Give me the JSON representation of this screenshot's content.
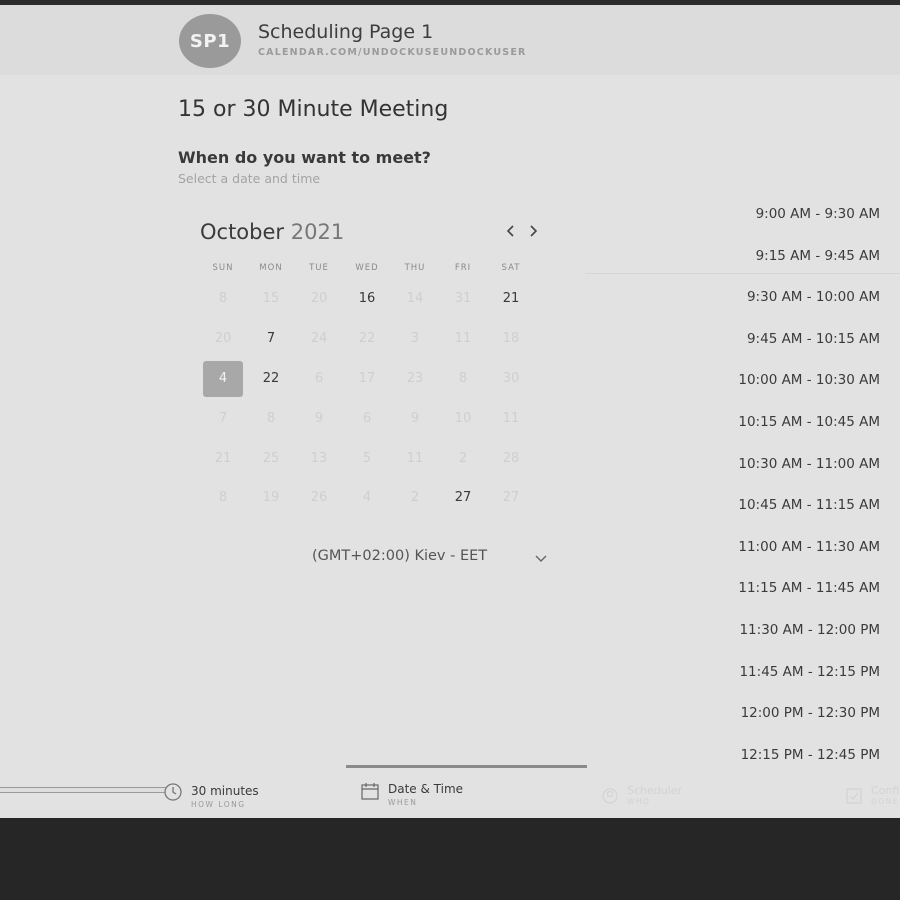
{
  "header": {
    "avatar_initials": "SP1",
    "title": "Scheduling Page 1",
    "url": "CALENDAR.COM/UNDOCKUSEUNDOCKUSER"
  },
  "meeting": {
    "title": "15 or 30 Minute Meeting",
    "question": "When do you want to meet?",
    "subtitle": "Select a date and time"
  },
  "calendar": {
    "month": "October",
    "year": "2021",
    "prev_icon": "chevron-left-icon",
    "next_icon": "chevron-right-icon",
    "weekdays": [
      "SUN",
      "MON",
      "TUE",
      "WED",
      "THU",
      "FRI",
      "SAT"
    ],
    "weeks": [
      [
        {
          "d": "8",
          "a": false
        },
        {
          "d": "15",
          "a": false
        },
        {
          "d": "20",
          "a": false
        },
        {
          "d": "16",
          "a": true
        },
        {
          "d": "14",
          "a": false
        },
        {
          "d": "31",
          "a": false
        },
        {
          "d": "21",
          "a": true
        }
      ],
      [
        {
          "d": "20",
          "a": false
        },
        {
          "d": "7",
          "a": true
        },
        {
          "d": "24",
          "a": false
        },
        {
          "d": "22",
          "a": false
        },
        {
          "d": "3",
          "a": false
        },
        {
          "d": "11",
          "a": false
        },
        {
          "d": "18",
          "a": false
        }
      ],
      [
        {
          "d": "4",
          "a": true,
          "selected": true
        },
        {
          "d": "22",
          "a": true
        },
        {
          "d": "6",
          "a": false
        },
        {
          "d": "17",
          "a": false
        },
        {
          "d": "23",
          "a": false
        },
        {
          "d": "8",
          "a": false
        },
        {
          "d": "30",
          "a": false
        }
      ],
      [
        {
          "d": "7",
          "a": false
        },
        {
          "d": "8",
          "a": false
        },
        {
          "d": "9",
          "a": false
        },
        {
          "d": "6",
          "a": false
        },
        {
          "d": "9",
          "a": false
        },
        {
          "d": "10",
          "a": false
        },
        {
          "d": "11",
          "a": false
        }
      ],
      [
        {
          "d": "21",
          "a": false
        },
        {
          "d": "25",
          "a": false
        },
        {
          "d": "13",
          "a": false
        },
        {
          "d": "5",
          "a": false
        },
        {
          "d": "11",
          "a": false
        },
        {
          "d": "2",
          "a": false
        },
        {
          "d": "28",
          "a": false
        }
      ],
      [
        {
          "d": "8",
          "a": false
        },
        {
          "d": "19",
          "a": false
        },
        {
          "d": "26",
          "a": false
        },
        {
          "d": "4",
          "a": false
        },
        {
          "d": "2",
          "a": false
        },
        {
          "d": "27",
          "a": true
        },
        {
          "d": "27",
          "a": false
        }
      ]
    ]
  },
  "timezone": {
    "label": "(GMT+02:00) Kiev - EET",
    "icon": "chevron-down-icon"
  },
  "time_slots": [
    "9:00 AM - 9:30 AM",
    "9:15 AM - 9:45 AM",
    "9:30 AM - 10:00 AM",
    "9:45 AM - 10:15 AM",
    "10:00 AM - 10:30 AM",
    "10:15 AM - 10:45 AM",
    "10:30 AM - 11:00 AM",
    "10:45 AM - 11:15 AM",
    "11:00 AM - 11:30 AM",
    "11:15 AM - 11:45 AM",
    "11:30 AM - 12:00 PM",
    "11:45 AM - 12:15 PM",
    "12:00 PM - 12:30 PM",
    "12:15 PM - 12:45 PM"
  ],
  "steps": [
    {
      "label": "30 minutes",
      "sub": "HOW LONG",
      "icon": "clock-icon"
    },
    {
      "label": "Date & Time",
      "sub": "WHEN",
      "icon": "calendar-icon"
    },
    {
      "label": "Scheduler",
      "sub": "WHO",
      "icon": "person-icon"
    },
    {
      "label": "Confirm",
      "sub": "DONE",
      "icon": "check-icon"
    }
  ],
  "colors": {
    "page_bg": "#e2e2e2",
    "selected_day": "#a8a8a8",
    "frame": "#262626"
  }
}
